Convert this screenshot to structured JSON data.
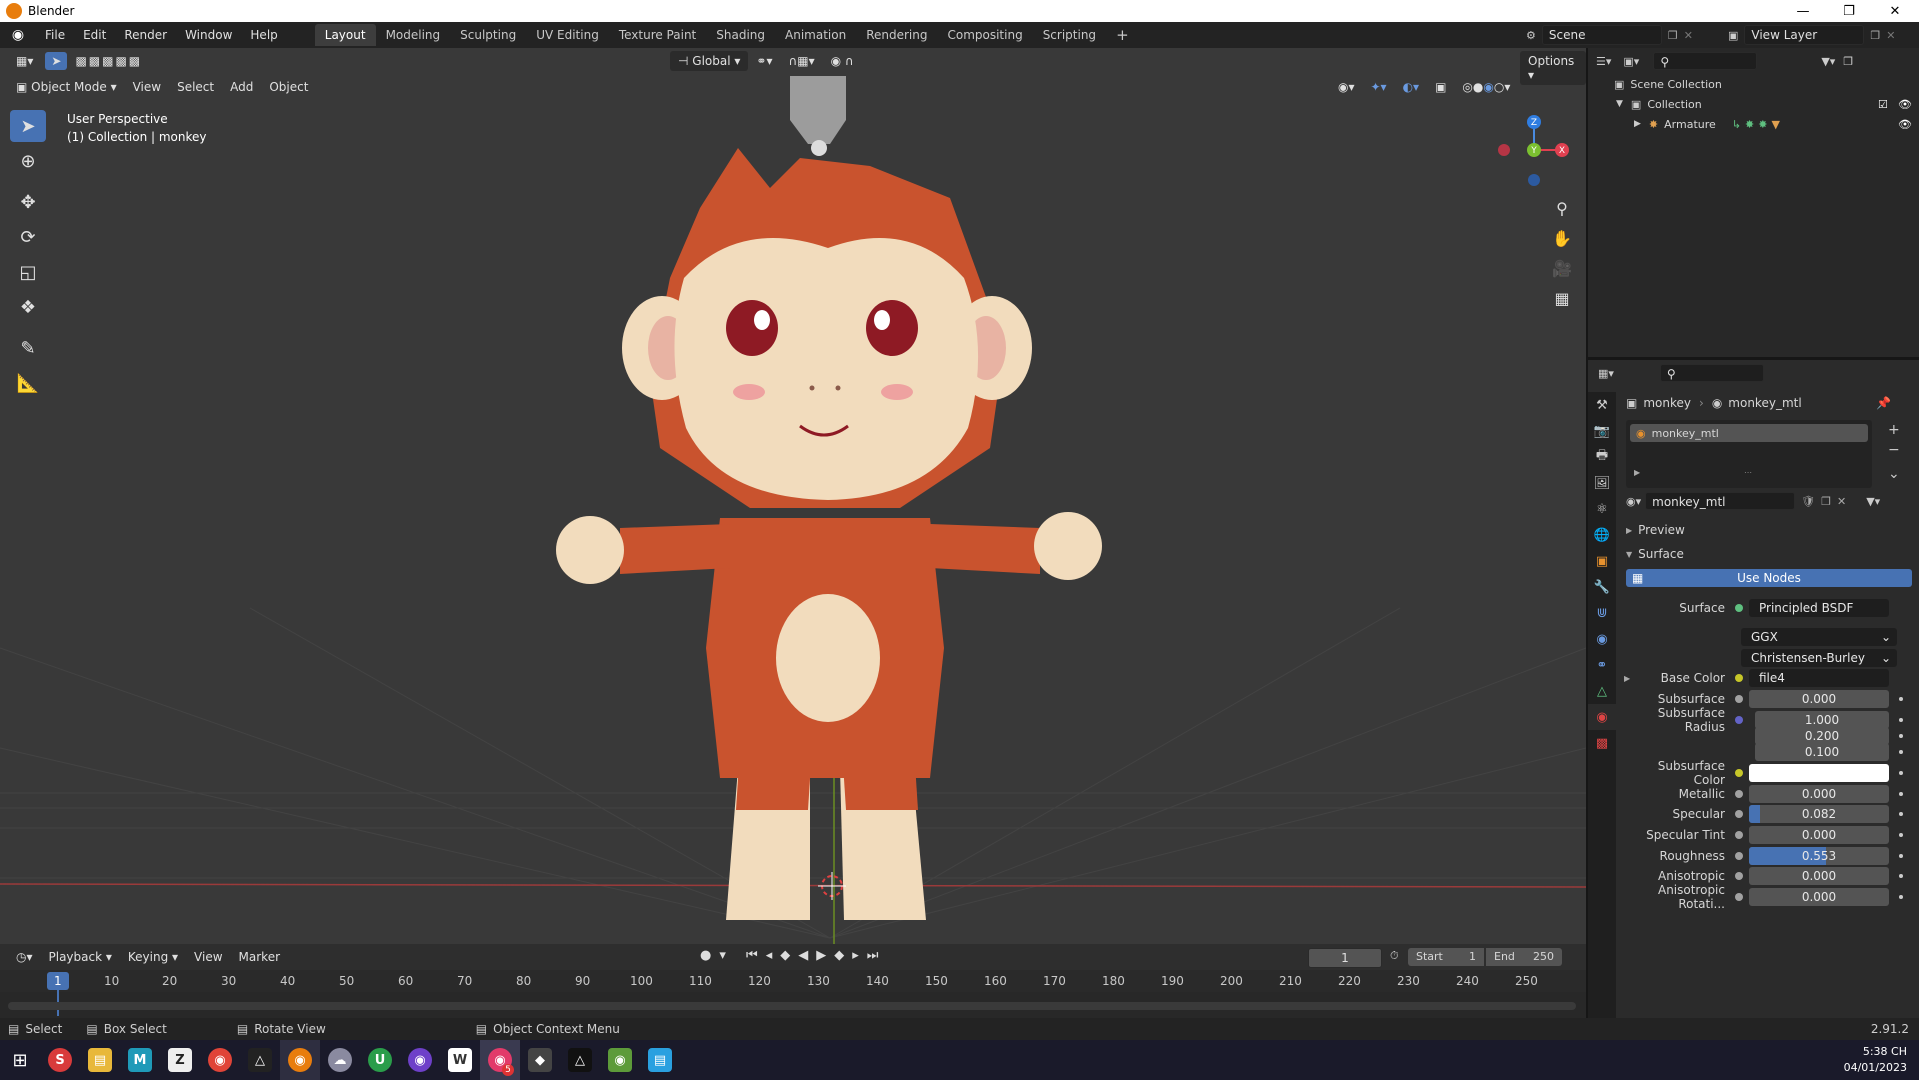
{
  "window": {
    "title": "Blender"
  },
  "menu": [
    "File",
    "Edit",
    "Render",
    "Window",
    "Help"
  ],
  "workspaces": [
    {
      "label": "Layout",
      "active": true
    },
    {
      "label": "Modeling"
    },
    {
      "label": "Sculpting"
    },
    {
      "label": "UV Editing"
    },
    {
      "label": "Texture Paint"
    },
    {
      "label": "Shading"
    },
    {
      "label": "Animation"
    },
    {
      "label": "Rendering"
    },
    {
      "label": "Compositing"
    },
    {
      "label": "Scripting"
    }
  ],
  "scene": {
    "name": "Scene",
    "view_layer": "View Layer"
  },
  "viewport": {
    "transform_orientation": "Global",
    "options_label": "Options",
    "mode": "Object Mode",
    "menus": [
      "View",
      "Select",
      "Add",
      "Object"
    ],
    "info_line1": "User Perspective",
    "info_line2": "(1) Collection | monkey",
    "gizmo": {
      "x": "X",
      "y": "Y",
      "z": "Z"
    }
  },
  "timeline": {
    "menus": [
      "Playback",
      "Keying",
      "View",
      "Marker"
    ],
    "current_frame": "1",
    "start_label": "Start",
    "start": "1",
    "end_label": "End",
    "end": "250",
    "ticks": [
      "1",
      "10",
      "20",
      "30",
      "40",
      "50",
      "60",
      "70",
      "80",
      "90",
      "100",
      "110",
      "120",
      "130",
      "140",
      "150",
      "160",
      "170",
      "180",
      "190",
      "200",
      "210",
      "220",
      "230",
      "240",
      "250"
    ]
  },
  "status": {
    "select": "Select",
    "box_select": "Box Select",
    "rotate_view": "Rotate View",
    "context_menu": "Object Context Menu",
    "version": "2.91.2"
  },
  "outliner": {
    "scene_collection": "Scene Collection",
    "collection": "Collection",
    "armature": "Armature"
  },
  "properties": {
    "object_name": "monkey",
    "material_name": "monkey_mtl",
    "slot_name": "monkey_mtl",
    "datablock": "monkey_mtl",
    "preview_label": "Preview",
    "surface_panel": "Surface",
    "use_nodes": "Use Nodes",
    "surface_label": "Surface",
    "surface_value": "Principled BSDF",
    "distribution": "GGX",
    "subsurface_method": "Christensen-Burley",
    "rows": [
      {
        "label": "Base Color",
        "value": "file4",
        "dot": "#c7c729",
        "dark": true
      },
      {
        "label": "Subsurface",
        "value": "0.000"
      },
      {
        "label": "Subsurface Radius",
        "value": "1.000",
        "dot": "#6363c7"
      },
      {
        "label": "",
        "value": "0.200"
      },
      {
        "label": "",
        "value": "0.100"
      },
      {
        "label": "Subsurface Color",
        "value": "",
        "dot": "#c7c729",
        "white": true
      },
      {
        "label": "Metallic",
        "value": "0.000"
      },
      {
        "label": "Specular",
        "value": "0.082",
        "fill": 0.082
      },
      {
        "label": "Specular Tint",
        "value": "0.000"
      },
      {
        "label": "Roughness",
        "value": "0.553",
        "fill": 0.553
      },
      {
        "label": "Anisotropic",
        "value": "0.000"
      },
      {
        "label": "Anisotropic Rotati...",
        "value": "0.000"
      }
    ]
  },
  "taskbar": {
    "time": "5:38 CH",
    "date": "04/01/2023",
    "badge": "5"
  },
  "colors": {
    "accent": "#4772b3",
    "viewport_bg": "#393939",
    "monkey_orange": "#c9532e",
    "monkey_cream": "#f2d9b5"
  }
}
